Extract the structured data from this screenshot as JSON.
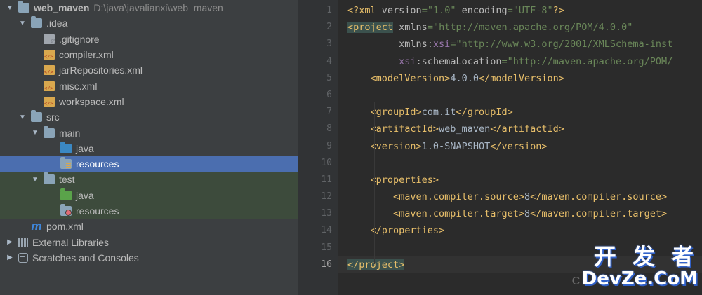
{
  "project_tree": {
    "root": {
      "name": "web_maven",
      "path": "D:\\java\\javalianxi\\web_maven"
    },
    "idea_folder": ".idea",
    "idea_files": [
      ".gitignore",
      "compiler.xml",
      "jarRepositories.xml",
      "misc.xml",
      "workspace.xml"
    ],
    "src_folder": "src",
    "main_folder": "main",
    "main_java": "java",
    "main_resources": "resources",
    "test_folder": "test",
    "test_java": "java",
    "test_resources": "resources",
    "pom": "pom.xml",
    "external_libraries": "External Libraries",
    "scratches": "Scratches and Consoles"
  },
  "editor": {
    "line_numbers": [
      "1",
      "2",
      "3",
      "4",
      "5",
      "6",
      "7",
      "8",
      "9",
      "10",
      "11",
      "12",
      "13",
      "14",
      "15",
      "16"
    ],
    "current_line": 16,
    "lines": [
      {
        "pi_open": "<?xml ",
        "a1": "version",
        "v1": "=\"1.0\"",
        "a2": " encoding",
        "v2": "=\"UTF-8\"",
        "pi_close": "?>"
      },
      {
        "tag": "<project",
        "a1": " xmlns",
        "v1": "=\"http://maven.apache.org/POM/4.0.0\""
      },
      {
        "a1": "         xmlns:",
        "ns": "xsi",
        "v1": "=\"http://www.w3.org/2001/XMLSchema-inst"
      },
      {
        "ns": "         xsi",
        "a1": ":schemaLocation",
        "v1": "=\"http://maven.apache.org/POM/"
      },
      {
        "open": "    <modelVersion>",
        "text": "4.0.0",
        "close": "</modelVersion>"
      },
      {},
      {
        "open": "    <groupId>",
        "text": "com.it",
        "close": "</groupId>"
      },
      {
        "open": "    <artifactId>",
        "text": "web_maven",
        "close": "</artifactId>"
      },
      {
        "open": "    <version>",
        "text": "1.0-SNAPSHOT",
        "close": "</version>"
      },
      {},
      {
        "open": "    <properties>"
      },
      {
        "open": "        <maven.compiler.source>",
        "text": "8",
        "close": "</maven.compiler.source>"
      },
      {
        "open": "        <maven.compiler.target>",
        "text": "8",
        "close": "</maven.compiler.target>"
      },
      {
        "open": "    </properties>"
      },
      {},
      {
        "open": "</project>"
      }
    ]
  },
  "watermark": {
    "line1": "开 发 者",
    "line2": "DevZe.CoM",
    "prefix": "C"
  },
  "colors": {
    "selected_row": "#4b6eaf",
    "test_row": "#3d4b3c",
    "tag": "#e8bf6a",
    "attr_value": "#6a8759",
    "namespace": "#9876aa"
  }
}
